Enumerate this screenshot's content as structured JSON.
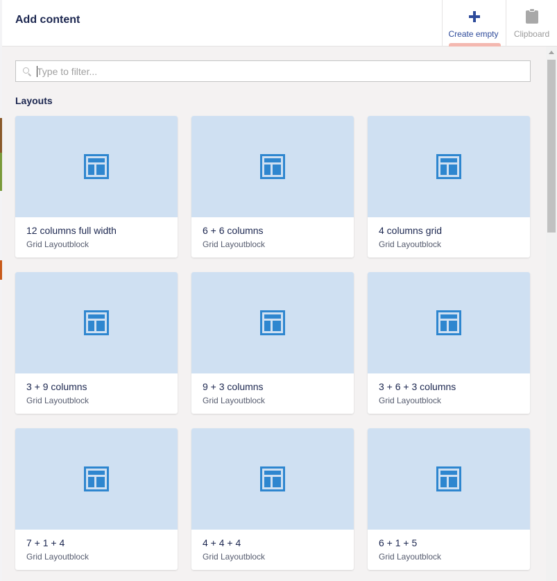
{
  "header": {
    "title": "Add content",
    "create_empty_label": "Create empty",
    "clipboard_label": "Clipboard",
    "accent_color": "#2d4a9a",
    "active_indicator_color": "#f4b8b0"
  },
  "filter": {
    "placeholder": "Type to filter...",
    "value": ""
  },
  "section": {
    "title": "Layouts"
  },
  "cards": [
    {
      "title": "12 columns full width",
      "subtitle": "Grid Layoutblock",
      "icon": "layout-icon"
    },
    {
      "title": "6 + 6 columns",
      "subtitle": "Grid Layoutblock",
      "icon": "layout-icon"
    },
    {
      "title": "4 columns grid",
      "subtitle": "Grid Layoutblock",
      "icon": "layout-icon"
    },
    {
      "title": "3 + 9 columns",
      "subtitle": "Grid Layoutblock",
      "icon": "layout-icon"
    },
    {
      "title": "9 + 3 columns",
      "subtitle": "Grid Layoutblock",
      "icon": "layout-icon"
    },
    {
      "title": "3 + 6 + 3 columns",
      "subtitle": "Grid Layoutblock",
      "icon": "layout-icon"
    },
    {
      "title": "7 + 1 + 4",
      "subtitle": "Grid Layoutblock",
      "icon": "layout-icon"
    },
    {
      "title": "4 + 4 + 4",
      "subtitle": "Grid Layoutblock",
      "icon": "layout-icon"
    },
    {
      "title": "6 + 1 + 5",
      "subtitle": "Grid Layoutblock",
      "icon": "layout-icon"
    }
  ],
  "colors": {
    "card_preview_bg": "#cfe0f2",
    "card_icon": "#2e86cf",
    "panel_bg": "#f4f2f2"
  }
}
